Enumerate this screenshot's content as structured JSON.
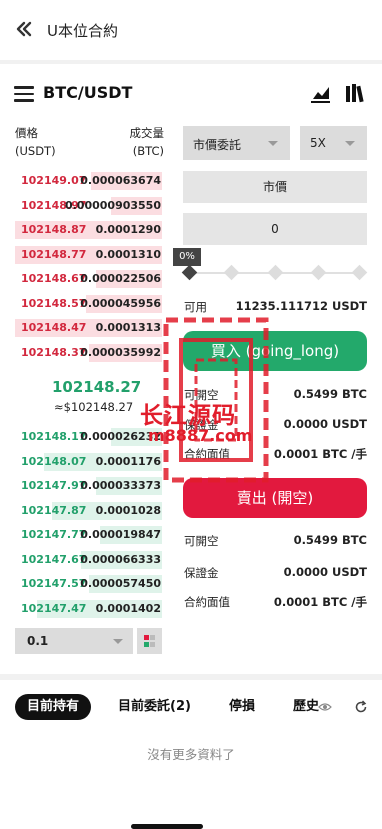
{
  "header": {
    "title": "U本位合約",
    "back_icon": "double-chevron-left-icon"
  },
  "pair": {
    "symbol": "BTC/USDT",
    "menu_icon": "hamburger-menu-icon",
    "chart_icon": "line-chart-icon",
    "library_icon": "books-icon"
  },
  "orderbook": {
    "price_header_1": "價格",
    "price_header_2": "(USDT)",
    "qty_header_1": "成交量",
    "qty_header_2": "(BTC)",
    "asks": [
      {
        "price": "102149.07",
        "qty": "0.000063674",
        "depth": 0.48
      },
      {
        "price": "102148.97",
        "qty": "0.00000903550",
        "depth": 0.35
      },
      {
        "price": "102148.87",
        "qty": "0.0001290",
        "depth": 1.0
      },
      {
        "price": "102148.77",
        "qty": "0.0001310",
        "depth": 1.0
      },
      {
        "price": "102148.67",
        "qty": "0.000022506",
        "depth": 0.45
      },
      {
        "price": "102148.57",
        "qty": "0.000045956",
        "depth": 0.52
      },
      {
        "price": "102148.47",
        "qty": "0.0001313",
        "depth": 1.0
      },
      {
        "price": "102148.37",
        "qty": "0.000035992",
        "depth": 0.5
      }
    ],
    "last_price": "102148.27",
    "last_price_fiat": "≈$102148.27",
    "bids": [
      {
        "price": "102148.17",
        "qty": "0.000026232",
        "depth": 0.35
      },
      {
        "price": "102148.07",
        "qty": "0.0001176",
        "depth": 0.8
      },
      {
        "price": "102147.97",
        "qty": "0.000033373",
        "depth": 0.45
      },
      {
        "price": "102147.87",
        "qty": "0.0001028",
        "depth": 0.75
      },
      {
        "price": "102147.77",
        "qty": "0.000019847",
        "depth": 0.42
      },
      {
        "price": "102147.67",
        "qty": "0.000066333",
        "depth": 0.55
      },
      {
        "price": "102147.57",
        "qty": "0.000057450",
        "depth": 0.5
      },
      {
        "price": "102147.47",
        "qty": "0.0001402",
        "depth": 0.85
      }
    ],
    "depth_precision": "0.1"
  },
  "form": {
    "order_type": "市價委託",
    "leverage": "5X",
    "price_field": "市價",
    "amount_field": "0",
    "slider_pct": "0%",
    "available_label": "可用",
    "available_value": "11235.111712 USDT",
    "buy_button": "買入 (going_long)",
    "sell_button": "賣出 (開空)",
    "buy_info": [
      {
        "label": "可開空",
        "value": "0.5499 BTC"
      },
      {
        "label": "保證金",
        "value": "0.0000 USDT"
      },
      {
        "label": "合約面值",
        "value": "0.0001 BTC /手"
      }
    ],
    "sell_info": [
      {
        "label": "可開空",
        "value": "0.5499 BTC"
      },
      {
        "label": "保證金",
        "value": "0.0000 USDT"
      },
      {
        "label": "合約面值",
        "value": "0.0001 BTC /手"
      }
    ]
  },
  "tabs": [
    "目前持有",
    "目前委託(2)",
    "停損",
    "歷史"
  ],
  "empty_message": "沒有更多資料了",
  "watermark": {
    "text": "长江源码",
    "url": "m8887.com"
  },
  "colors": {
    "buy": "#23a96b",
    "sell": "#e2193e",
    "ask_price": "#d2283e",
    "bid_price": "#22a06b"
  }
}
